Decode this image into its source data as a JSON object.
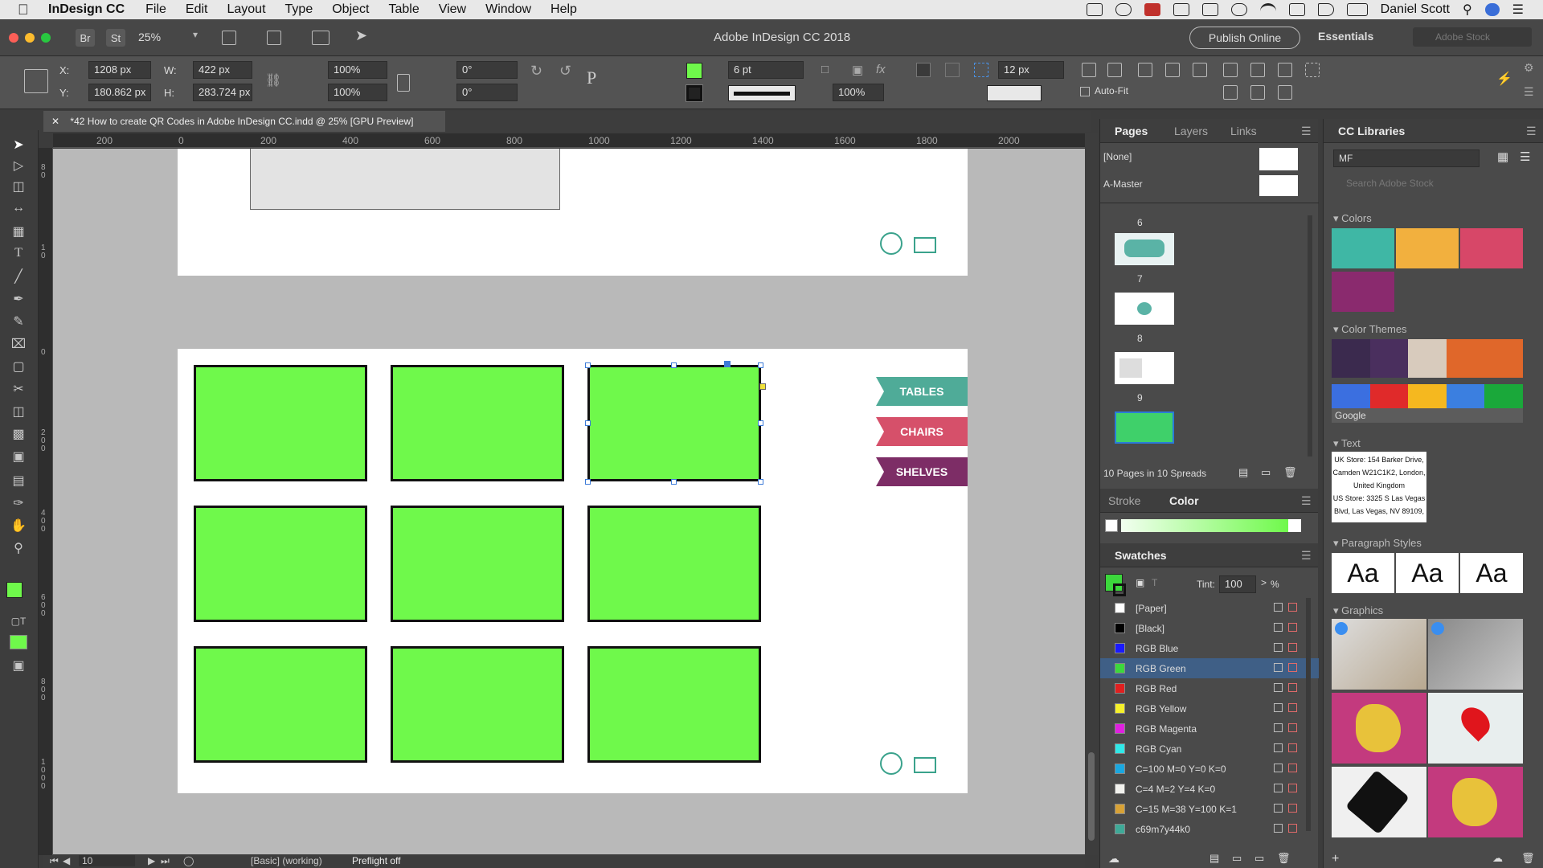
{
  "menubar": {
    "app": "InDesign CC",
    "items": [
      "File",
      "Edit",
      "Layout",
      "Type",
      "Object",
      "Table",
      "View",
      "Window",
      "Help"
    ],
    "user": "Daniel Scott"
  },
  "appbar": {
    "title": "Adobe InDesign CC 2018",
    "zoom": "25%",
    "br": "Br",
    "st": "St",
    "publish": "Publish Online",
    "workspace": "Essentials",
    "search_placeholder": "Adobe Stock"
  },
  "control": {
    "x_label": "X:",
    "x": "1208 px",
    "y_label": "Y:",
    "y": "180.862 px",
    "w_label": "W:",
    "w": "422 px",
    "h_label": "H:",
    "h": "283.724 px",
    "scale_x": "100%",
    "scale_y": "100%",
    "rot": "0°",
    "shear": "0°",
    "stroke_weight": "6 pt",
    "opacity": "100%",
    "gap": "12 px",
    "autofit": "Auto-Fit"
  },
  "document": {
    "tab": "*42 How to create QR Codes in Adobe InDesign CC.indd @ 25% [GPU Preview]",
    "ruler_labels": [
      "200",
      "0",
      "200",
      "400",
      "600",
      "800",
      "1000",
      "1200",
      "1400",
      "1600",
      "1800",
      "2000"
    ],
    "vruler_labels": [
      "8 0",
      "1 0",
      "0",
      "2 0 0",
      "4 0 0",
      "6 0 0",
      "8 0 0",
      "1 0 0 0"
    ],
    "tags": [
      {
        "label": "TABLES",
        "color": "#4fab98"
      },
      {
        "label": "CHAIRS",
        "color": "#d6506a"
      },
      {
        "label": "SHELVES",
        "color": "#7d2d66"
      }
    ],
    "box_color": "#6ff94b"
  },
  "status": {
    "page": "10",
    "style": "[Basic] (working)",
    "preflight": "Preflight off"
  },
  "pages_panel": {
    "tabs": [
      "Pages",
      "Layers",
      "Links"
    ],
    "none": "[None]",
    "master": "A-Master",
    "page_numbers": [
      "6",
      "7",
      "8",
      "9"
    ],
    "footer": "10 Pages in 10 Spreads"
  },
  "color_panel": {
    "tabs": [
      "Stroke",
      "Color"
    ]
  },
  "swatches": {
    "title": "Swatches",
    "tint_label": "Tint:",
    "tint": "100",
    "percent": "%",
    "items": [
      {
        "name": "[Paper]",
        "color": "#ffffff"
      },
      {
        "name": "[Black]",
        "color": "#000000"
      },
      {
        "name": "RGB Blue",
        "color": "#1a1aff"
      },
      {
        "name": "RGB Green",
        "color": "#3cd83c",
        "selected": true
      },
      {
        "name": "RGB Red",
        "color": "#e02020"
      },
      {
        "name": "RGB Yellow",
        "color": "#f5f02a"
      },
      {
        "name": "RGB Magenta",
        "color": "#e020e0"
      },
      {
        "name": "RGB Cyan",
        "color": "#30e8e8"
      },
      {
        "name": "C=100 M=0 Y=0 K=0",
        "color": "#1aa8e0"
      },
      {
        "name": "C=4 M=2 Y=4 K=0",
        "color": "#f2f2ee"
      },
      {
        "name": "C=15 M=38 Y=100 K=1",
        "color": "#d8a236"
      },
      {
        "name": "c69m7y44k0",
        "color": "#3faa98"
      }
    ]
  },
  "libraries": {
    "title": "CC Libraries",
    "library": "MF",
    "search_placeholder": "Search Adobe Stock",
    "colors_label": "Colors",
    "colors": [
      "#3fb7a5",
      "#f2b03e",
      "#d74768",
      "#8a2a6e"
    ],
    "themes_label": "Color Themes",
    "theme1": [
      "#3b2a4e",
      "#4a2f5e",
      "#d8cbbd",
      "#e0672a",
      "#e0672a"
    ],
    "theme2": [
      "#3b6fe0",
      "#e02a2a",
      "#f5b81f",
      "#3b7fe0",
      "#1aa83a"
    ],
    "theme2_name": "Google",
    "text_label": "Text",
    "text_sample": [
      "UK Store: 154 Barker Drive,",
      "Camden W21C1K2, London,",
      "United Kingdom",
      "US Store: 3325 S Las Vegas",
      "Blvd, Las Vegas, NV 89109,"
    ],
    "para_label": "Paragraph Styles",
    "aa": "Aa",
    "graphics_label": "Graphics"
  }
}
